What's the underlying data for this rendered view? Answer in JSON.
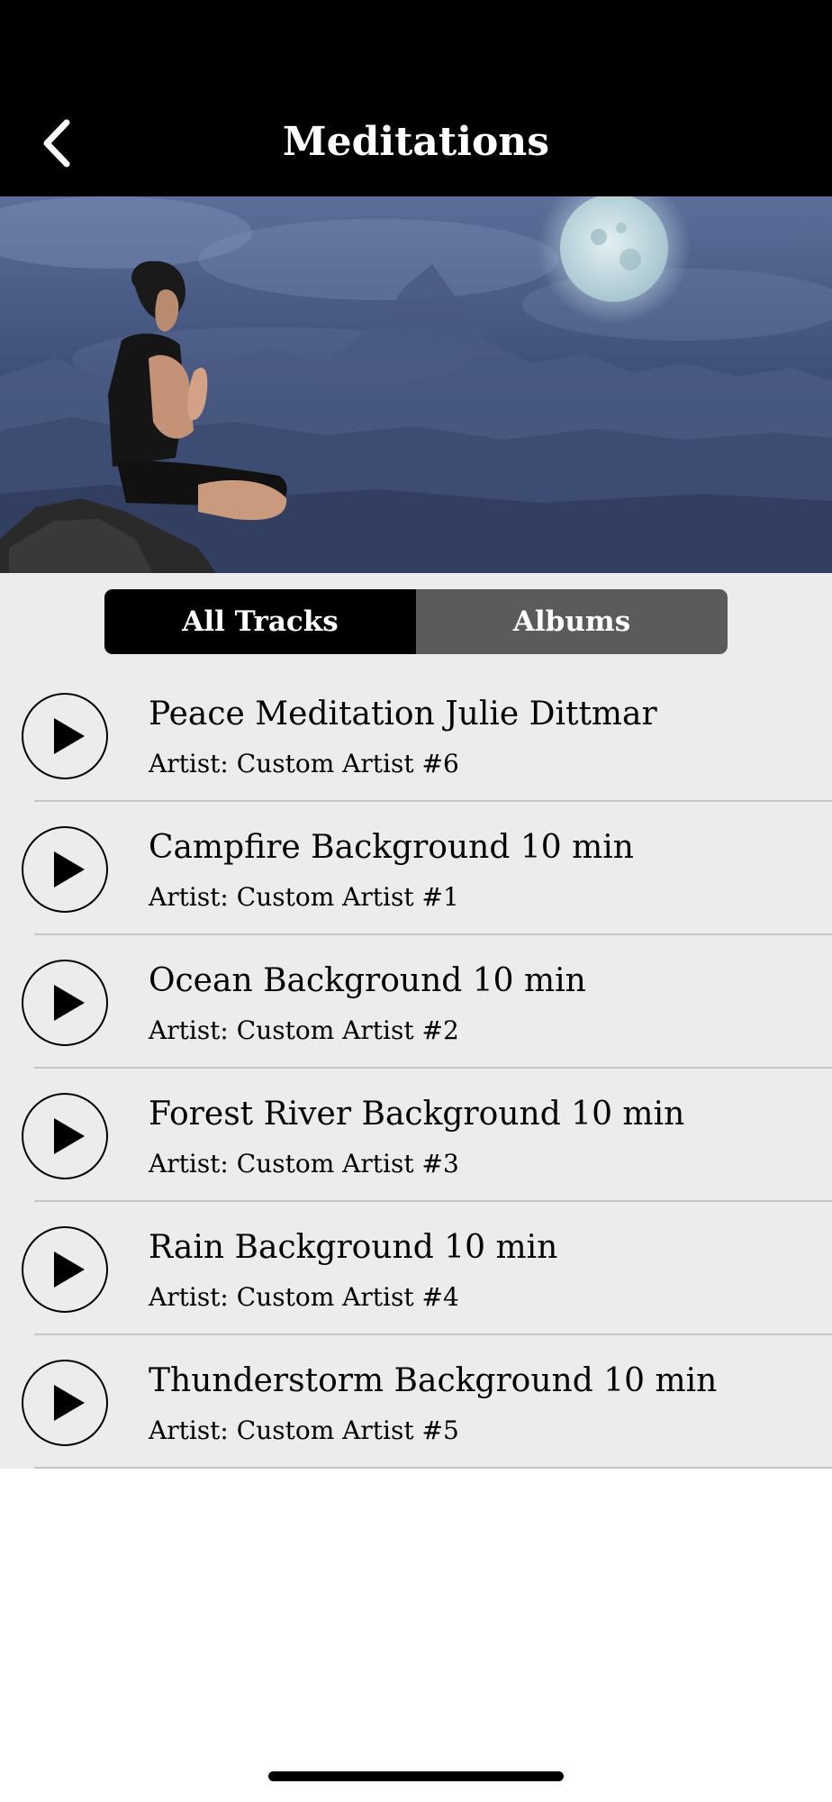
{
  "header": {
    "title": "Meditations",
    "back_icon": "chevron-left-icon"
  },
  "hero": {
    "description_icon": "meditation-hero-image"
  },
  "tabs": [
    {
      "label": "All Tracks",
      "active": true
    },
    {
      "label": "Albums",
      "active": false
    }
  ],
  "tracks": [
    {
      "title": "Peace Meditation Julie Dittmar",
      "artist": "Artist: Custom Artist #6"
    },
    {
      "title": "Campfire Background 10 min",
      "artist": "Artist: Custom Artist #1"
    },
    {
      "title": "Ocean Background 10 min",
      "artist": "Artist: Custom Artist #2"
    },
    {
      "title": "Forest River Background 10 min",
      "artist": "Artist: Custom Artist #3"
    },
    {
      "title": "Rain Background 10 min",
      "artist": "Artist: Custom Artist #4"
    },
    {
      "title": "Thunderstorm Background 10 min",
      "artist": "Artist: Custom Artist #5"
    }
  ],
  "colors": {
    "header_bg": "#000000",
    "list_bg": "#ececec",
    "tab_active": "#000000",
    "tab_inactive": "#5b5b5b"
  }
}
